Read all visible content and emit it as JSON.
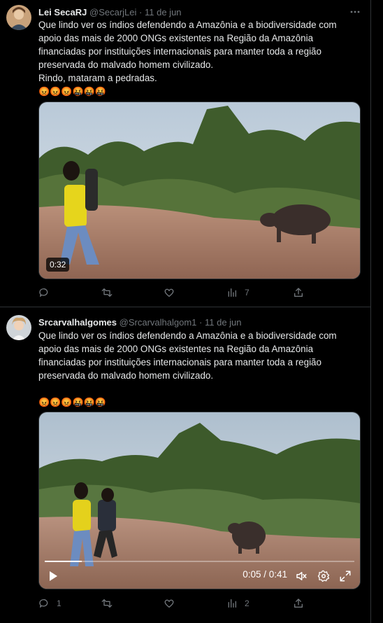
{
  "tweets": [
    {
      "name": "Lei SecaRJ",
      "handle": "@SecarjLei",
      "dot": "·",
      "date": "11 de jun",
      "text_lines": [
        "Que lindo ver os índios defendendo a Amazônia e a biodiversidade com",
        "apoio das mais de 2000 ONGs existentes na Região da Amazônia",
        "financiadas por instituições internacionais para manter toda a região",
        "preservada do malvado homem civilizado.",
        "Rindo, mataram a pedradas."
      ],
      "emoji_line": "😡😡😡🤬🤬🤬",
      "video_duration": "0:32",
      "actions": {
        "replies": "",
        "reposts": "",
        "likes": "",
        "views": "7"
      }
    },
    {
      "name": "Srcarvalhalgomes",
      "handle": "@Srcarvalhalgom1",
      "dot": "·",
      "date": "11 de jun",
      "text_lines": [
        "Que lindo ver os índios defendendo a Amazônia e a biodiversidade com",
        "apoio das mais de 2000 ONGs existentes na Região da Amazônia",
        "financiadas por instituições internacionais para manter toda a região",
        "preservada do malvado homem civilizado.",
        ""
      ],
      "emoji_line": "😡😡😡🤬🤬🤬",
      "video_time": "0:05 / 0:41",
      "video_progress": 0.12,
      "actions": {
        "replies": "1",
        "reposts": "",
        "likes": "",
        "views": "2"
      }
    }
  ],
  "colors": {
    "background": "#000000",
    "text": "#e7e9ea",
    "muted": "#71767b",
    "border": "#2f3336"
  }
}
